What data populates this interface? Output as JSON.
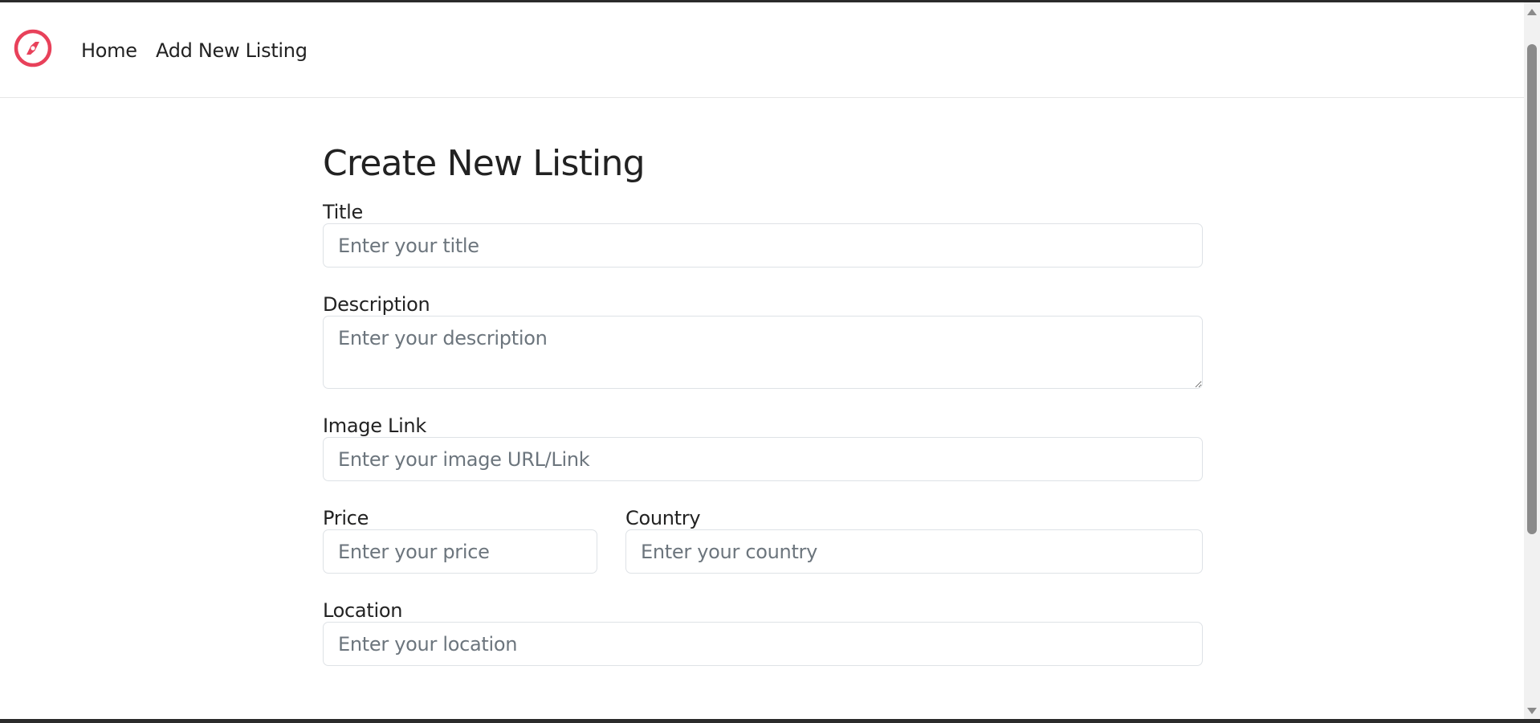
{
  "navbar": {
    "logo_icon": "compass-icon",
    "brand_color": "#e8415a",
    "links": [
      {
        "label": "Home"
      },
      {
        "label": "Add New Listing"
      }
    ]
  },
  "form": {
    "title": "Create New Listing",
    "fields": {
      "title": {
        "label": "Title",
        "placeholder": "Enter your title",
        "value": ""
      },
      "description": {
        "label": "Description",
        "placeholder": "Enter your description",
        "value": ""
      },
      "image": {
        "label": "Image Link",
        "placeholder": "Enter your image URL/Link",
        "value": ""
      },
      "price": {
        "label": "Price",
        "placeholder": "Enter your price",
        "value": ""
      },
      "country": {
        "label": "Country",
        "placeholder": "Enter your country",
        "value": ""
      },
      "location": {
        "label": "Location",
        "placeholder": "Enter your location",
        "value": ""
      }
    }
  }
}
